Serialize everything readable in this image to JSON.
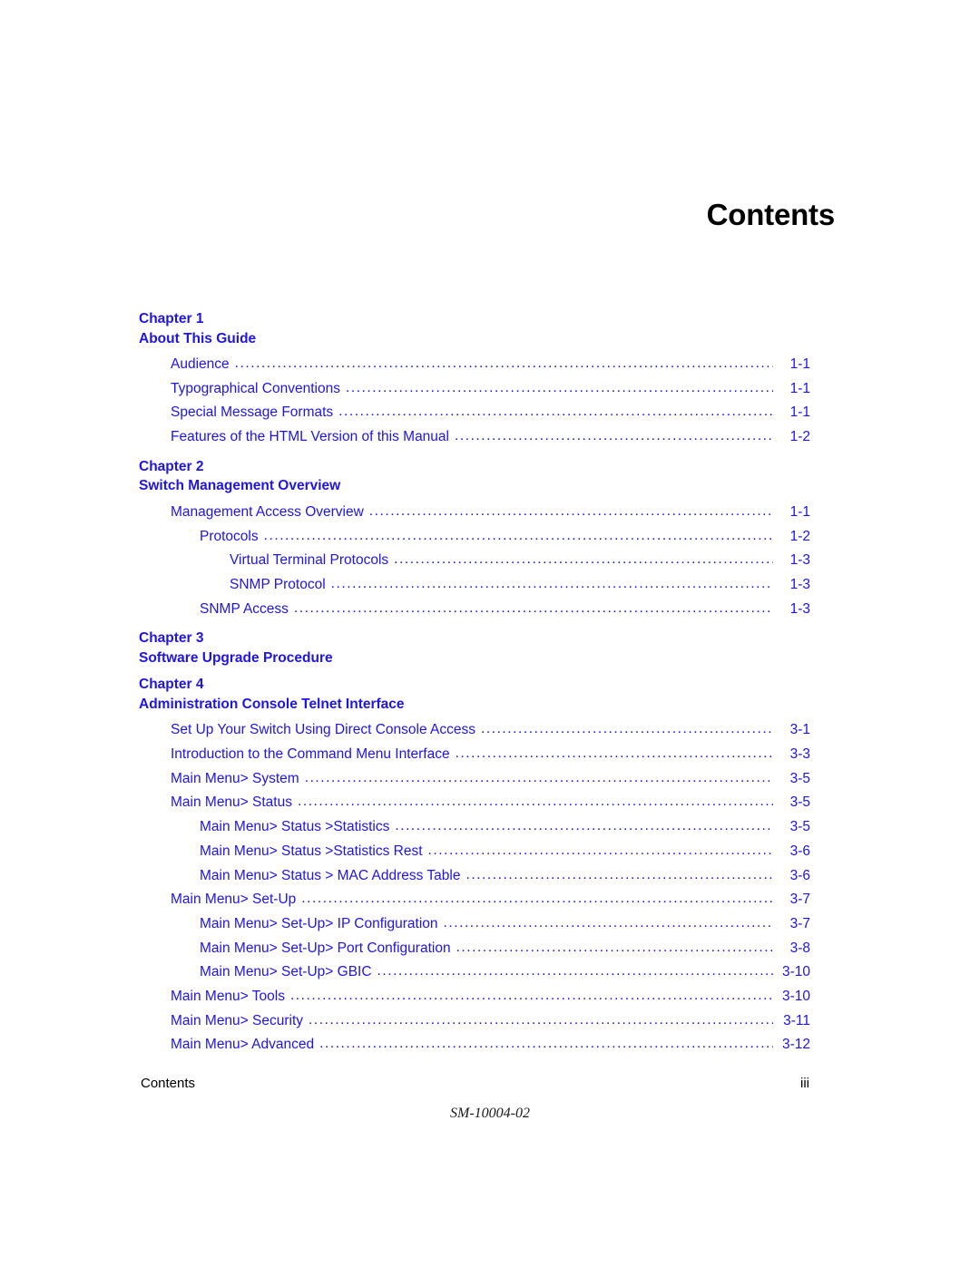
{
  "page": {
    "title": "Contents",
    "document_number": "SM-10004-02",
    "footer_label": "Contents",
    "page_number": "iii",
    "accent_color": "#1f14e6",
    "text_color": "#000000"
  },
  "toc": {
    "leader_dots": "..................................................................................................................................................................",
    "sections": [
      {
        "chapter_label": "Chapter 1",
        "chapter_title": "About This Guide",
        "entries": [
          {
            "text": "Audience",
            "page": "1-1",
            "level": 1
          },
          {
            "text": "Typographical Conventions",
            "page": "1-1",
            "level": 1
          },
          {
            "text": "Special Message Formats",
            "page": "1-1",
            "level": 1
          },
          {
            "text": "Features of the HTML Version of this Manual",
            "page": "1-2",
            "level": 1
          }
        ]
      },
      {
        "chapter_label": "Chapter 2",
        "chapter_title": "Switch Management Overview",
        "entries": [
          {
            "text": "Management Access Overview",
            "page": "1-1",
            "level": 1
          },
          {
            "text": "Protocols",
            "page": "1-2",
            "level": 2
          },
          {
            "text": "Virtual Terminal Protocols",
            "page": "1-3",
            "level": 3
          },
          {
            "text": "SNMP Protocol",
            "page": "1-3",
            "level": 3
          },
          {
            "text": "SNMP Access",
            "page": "1-3",
            "level": 2
          }
        ]
      },
      {
        "chapter_label": "Chapter 3",
        "chapter_title": "Software Upgrade Procedure",
        "entries": []
      },
      {
        "chapter_label": "Chapter 4",
        "chapter_title": "Administration Console Telnet Interface",
        "entries": [
          {
            "text": "Set Up Your Switch Using Direct Console Access",
            "page": "3-1",
            "level": 1
          },
          {
            "text": "Introduction to the Command Menu Interface",
            "page": "3-3",
            "level": 1
          },
          {
            "text": "Main Menu> System",
            "page": "3-5",
            "level": 1
          },
          {
            "text": "Main Menu> Status",
            "page": "3-5",
            "level": 1
          },
          {
            "text": "Main Menu> Status >Statistics",
            "page": "3-5",
            "level": 2
          },
          {
            "text": "Main Menu> Status >Statistics Rest",
            "page": "3-6",
            "level": 2
          },
          {
            "text": "Main Menu> Status > MAC Address Table",
            "page": "3-6",
            "level": 2
          },
          {
            "text": "Main Menu> Set-Up",
            "page": "3-7",
            "level": 1
          },
          {
            "text": "Main Menu> Set-Up> IP Configuration",
            "page": "3-7",
            "level": 2
          },
          {
            "text": "Main Menu> Set-Up> Port Configuration",
            "page": "3-8",
            "level": 2
          },
          {
            "text": "Main Menu> Set-Up> GBIC",
            "page": "3-10",
            "level": 2
          },
          {
            "text": "Main Menu> Tools",
            "page": "3-10",
            "level": 1
          },
          {
            "text": "Main Menu> Security",
            "page": "3-11",
            "level": 1
          },
          {
            "text": "Main Menu> Advanced",
            "page": "3-12",
            "level": 1
          }
        ]
      }
    ]
  }
}
